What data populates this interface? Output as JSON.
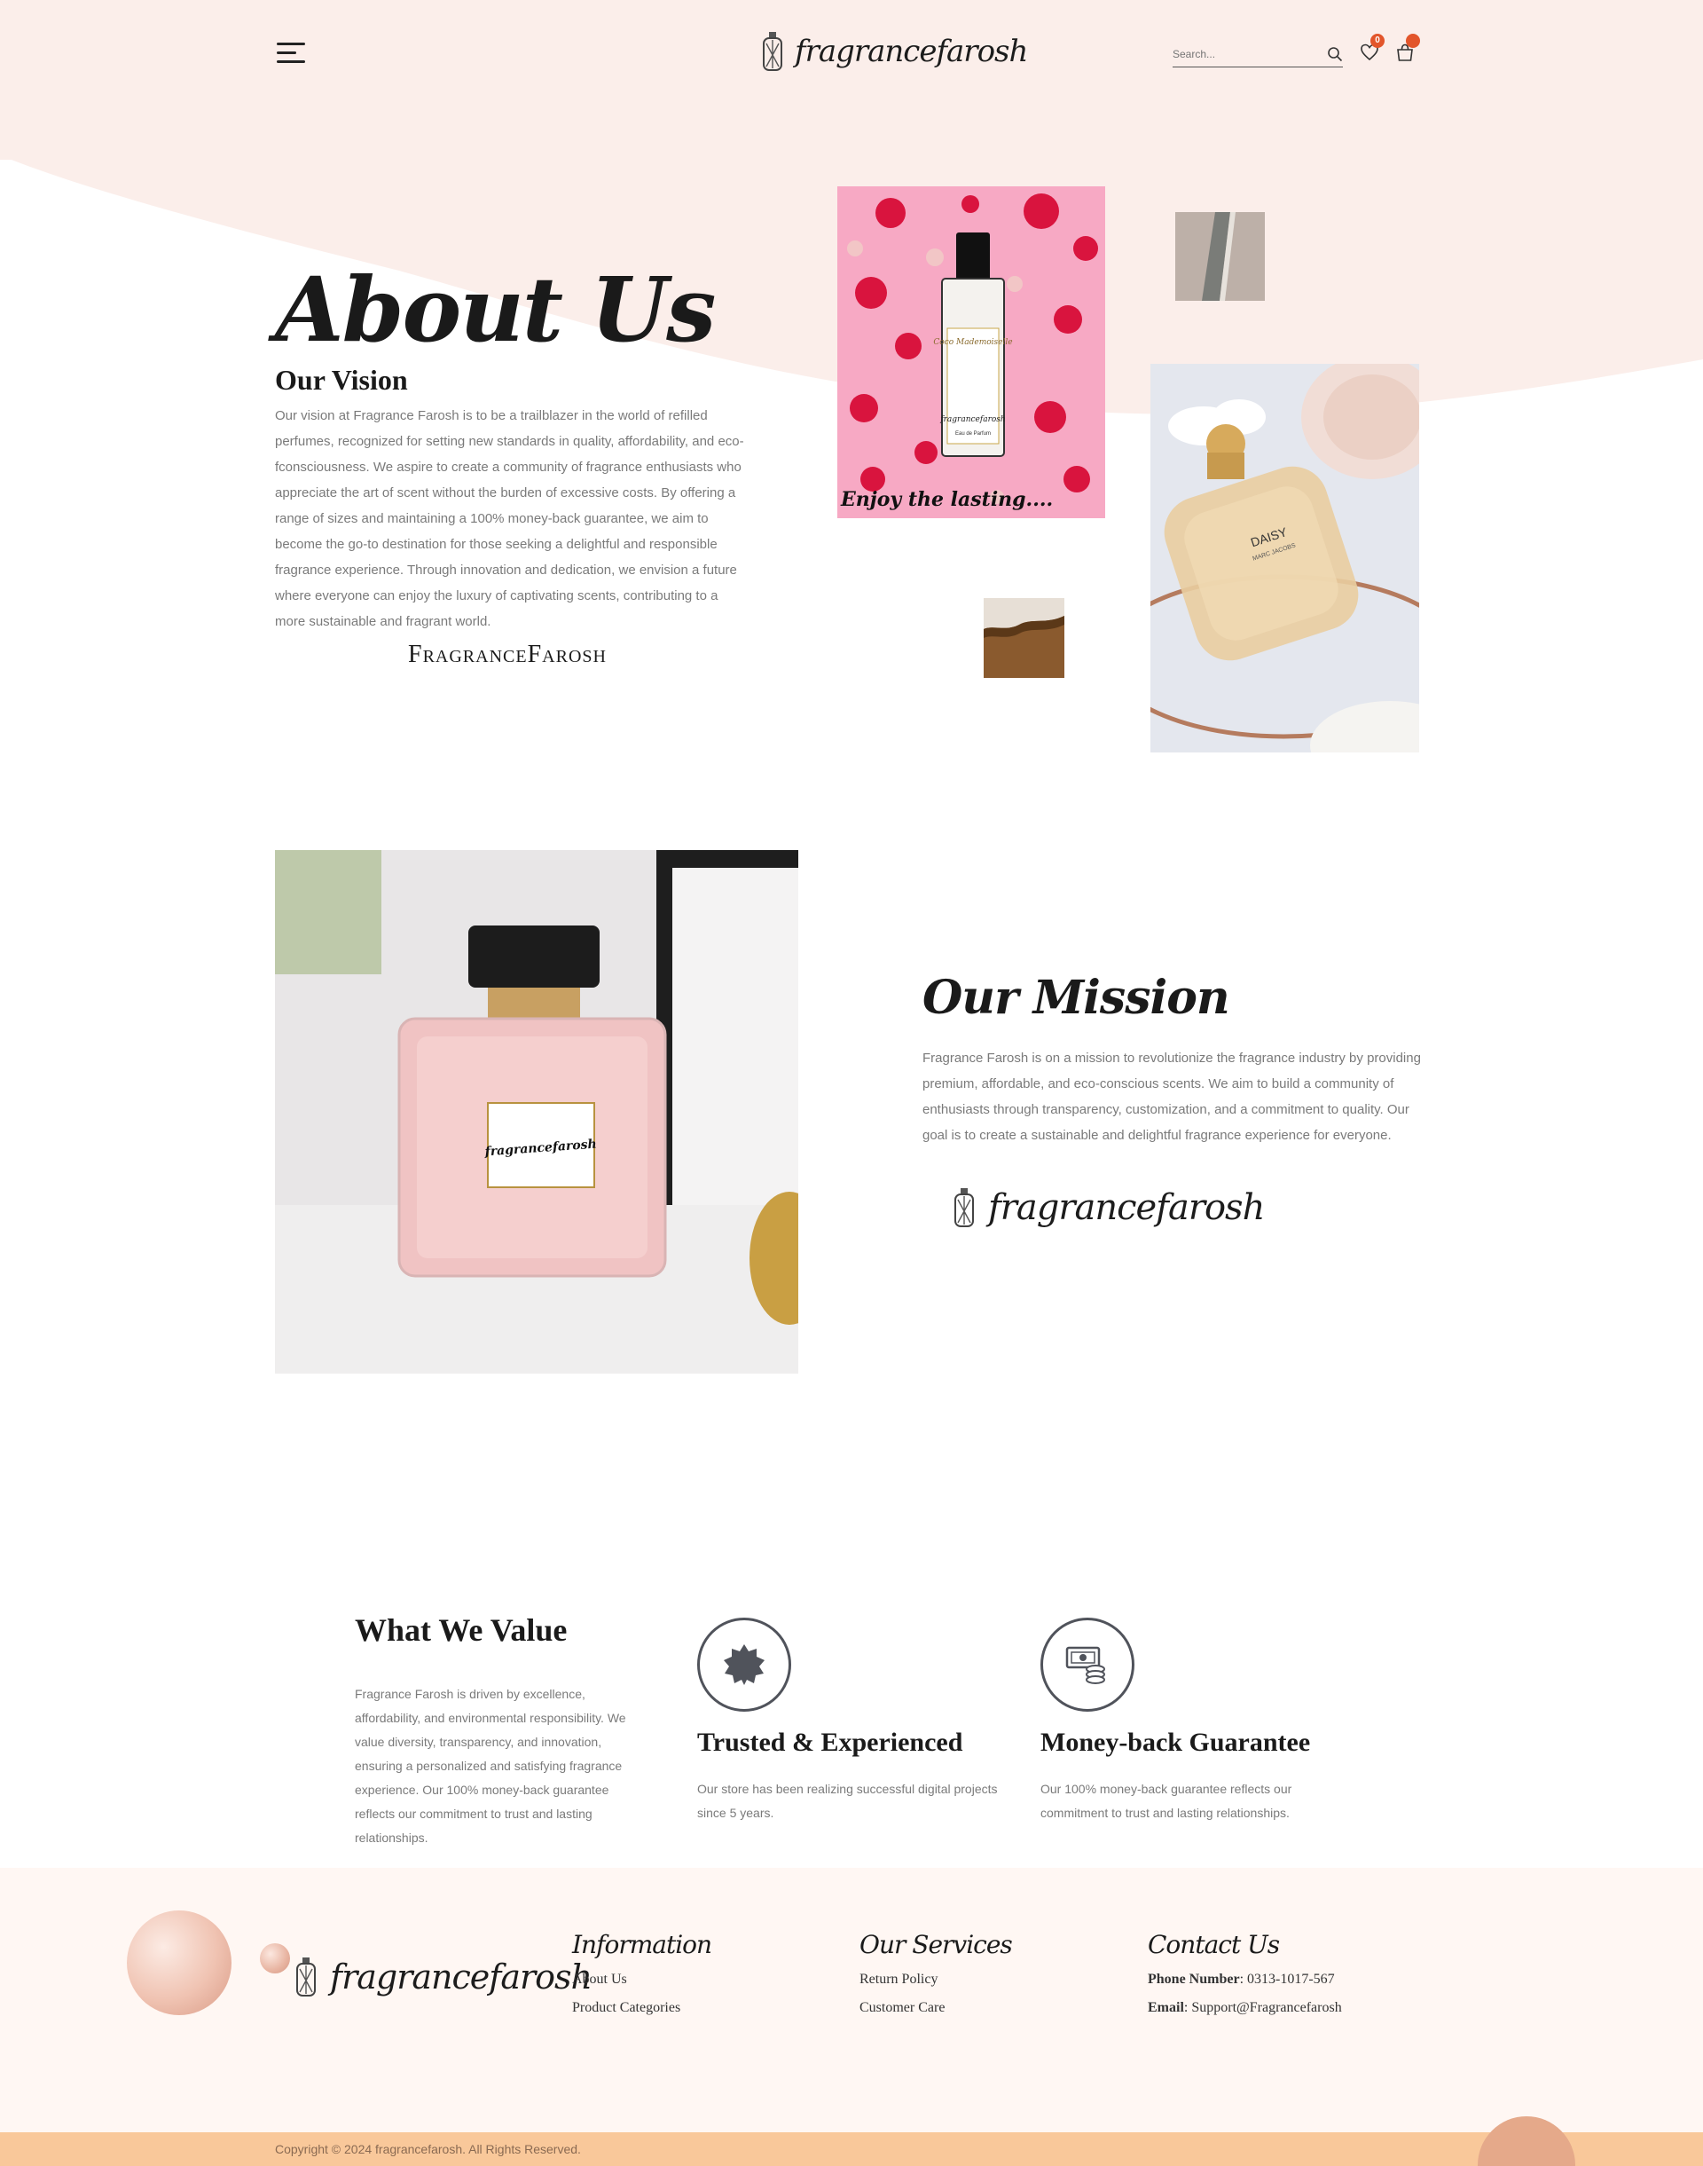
{
  "header": {
    "logo_text": "fragrancefarosh",
    "search_placeholder": "Search...",
    "wishlist_count": "0",
    "cart_count": ""
  },
  "vision": {
    "page_title": "About Us",
    "title": "Our Vision",
    "text": "Our vision at Fragrance Farosh is to be a trailblazer in the world of refilled perfumes, recognized for setting new standards in quality, affordability, and eco-fconsciousness. We aspire to create a community of fragrance enthusiasts who appreciate the art of scent without the burden of excessive costs. By offering a range of sizes and maintaining a 100% money-back guarantee, we aim to become the go-to destination for those seeking a delightful and responsible fragrance experience. Through innovation and dedication, we envision a future where everyone can enjoy the luxury of captivating scents, contributing to a more sustainable and fragrant world.",
    "signature": "FragranceFarosh"
  },
  "images": {
    "pink_caption": "Enjoy the lasting....",
    "pink_label_name": "Coco Mademoiselle",
    "pink_label_type": "Eau de Parfum",
    "daisy_label": "DAISY",
    "daisy_sublabel": "MARC JACOBS",
    "mission_label": "fragrancefarosh"
  },
  "mission": {
    "title": "Our Mission",
    "text": "Fragrance Farosh is on a mission to revolutionize the fragrance industry by providing premium, affordable, and eco-conscious scents. We aim to build a community of enthusiasts through transparency, customization, and a commitment to quality. Our goal is to create a sustainable and delightful fragrance experience for everyone.",
    "logo_text": "fragrancefarosh"
  },
  "values": {
    "title": "What We Value",
    "text": "Fragrance Farosh is driven by excellence, affordability, and environmental responsibility. We value diversity, transparency, and innovation, ensuring a personalized and satisfying fragrance experience. Our 100% money-back guarantee reflects our commitment to trust and lasting relationships.",
    "features": [
      {
        "title": "Trusted & Experienced",
        "text": "Our store has been realizing successful digital projects since 5 years.",
        "icon": "badge-icon"
      },
      {
        "title": "Money-back Guarantee",
        "text": "Our 100% money-back guarantee reflects our commitment to trust and lasting relationships.",
        "icon": "money-icon"
      }
    ]
  },
  "footer": {
    "logo_text": "fragrancefarosh",
    "information": {
      "title": "Information",
      "links": [
        "About Us",
        "Product Categories"
      ]
    },
    "services": {
      "title": "Our Services",
      "links": [
        "Return Policy",
        "Customer Care"
      ]
    },
    "contact": {
      "title": "Contact Us",
      "phone_label": "Phone Number",
      "phone": "0313-1017-567",
      "email_label": "Email",
      "email": "Support@Fragrancefarosh"
    },
    "copyright": "Copyright © 2024 fragrancefarosh. All Rights Reserved."
  },
  "colors": {
    "header_bg": "#fbeeea",
    "badge": "#e2552b",
    "footer_bg": "#fff7f3",
    "bottom_bar": "#f9c89a"
  }
}
